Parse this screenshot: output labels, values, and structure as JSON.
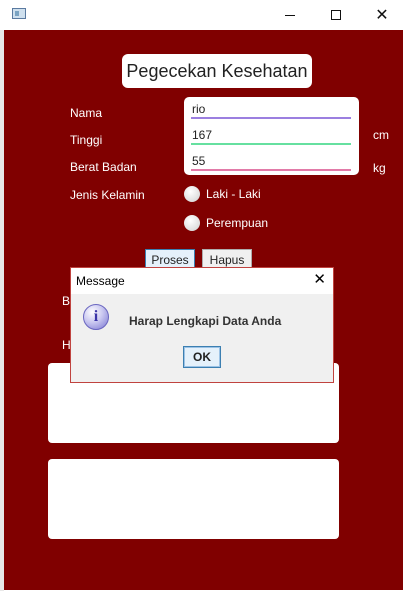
{
  "window": {
    "icon": "app-window-icon",
    "controls": {
      "minimize": "minimize-icon",
      "maximize": "maximize-icon",
      "close": "close-icon"
    }
  },
  "form": {
    "title": "Pegecekan Kesehatan",
    "nama_label": "Nama",
    "nama_value": "rio",
    "tinggi_label": "Tinggi",
    "tinggi_value": "167",
    "tinggi_unit": "cm",
    "berat_label": "Berat Badan",
    "berat_value": "55",
    "berat_unit": "kg",
    "gender_label": "Jenis Kelamin",
    "gender_options": [
      "Laki - Laki",
      "Perempuan"
    ],
    "proses_label": "Proses",
    "hapus_label": "Hapus",
    "partial_label_1": "B",
    "partial_label_2": "H"
  },
  "dialog": {
    "title": "Message",
    "message": "Harap Lengkapi Data Anda",
    "ok_label": "OK",
    "icon": "info-icon"
  },
  "colors": {
    "background": "#800000",
    "underline_nama": "#9b7fe0",
    "underline_tinggi": "#66e0a0",
    "underline_berat": "#e27aa8"
  }
}
